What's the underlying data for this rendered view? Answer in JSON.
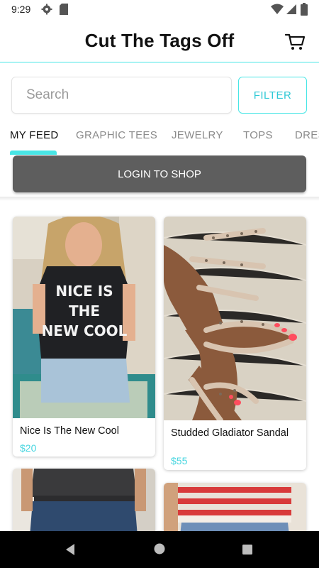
{
  "status_bar": {
    "time": "9:29",
    "icons": [
      "gear-icon",
      "sd-card-icon",
      "wifi-icon",
      "signal-icon",
      "battery-icon"
    ]
  },
  "header": {
    "title": "Cut The Tags Off",
    "cart_icon": "cart-icon"
  },
  "search": {
    "placeholder": "Search",
    "value": "",
    "filter_label": "FILTER"
  },
  "tabs": [
    {
      "label": "MY FEED",
      "active": true
    },
    {
      "label": "GRAPHIC TEES",
      "active": false
    },
    {
      "label": "JEWELRY",
      "active": false
    },
    {
      "label": "TOPS",
      "active": false
    },
    {
      "label": "DRESSES",
      "active": false
    }
  ],
  "login": {
    "label": "LOGIN TO SHOP"
  },
  "products": [
    {
      "name": "Nice Is The New Cool",
      "price": "$20",
      "shirt_text": "NICE IS THE NEW COOL"
    },
    {
      "name": "Studded Gladiator Sandal",
      "price": "$55"
    },
    {
      "name": "",
      "price": ""
    },
    {
      "name": "",
      "price": ""
    }
  ],
  "colors": {
    "accent": "#48e6e6",
    "price": "#48d6e0",
    "login_bg": "#5e5e5e"
  },
  "nav": {
    "icons": [
      "back-icon",
      "home-icon",
      "recents-icon"
    ]
  }
}
